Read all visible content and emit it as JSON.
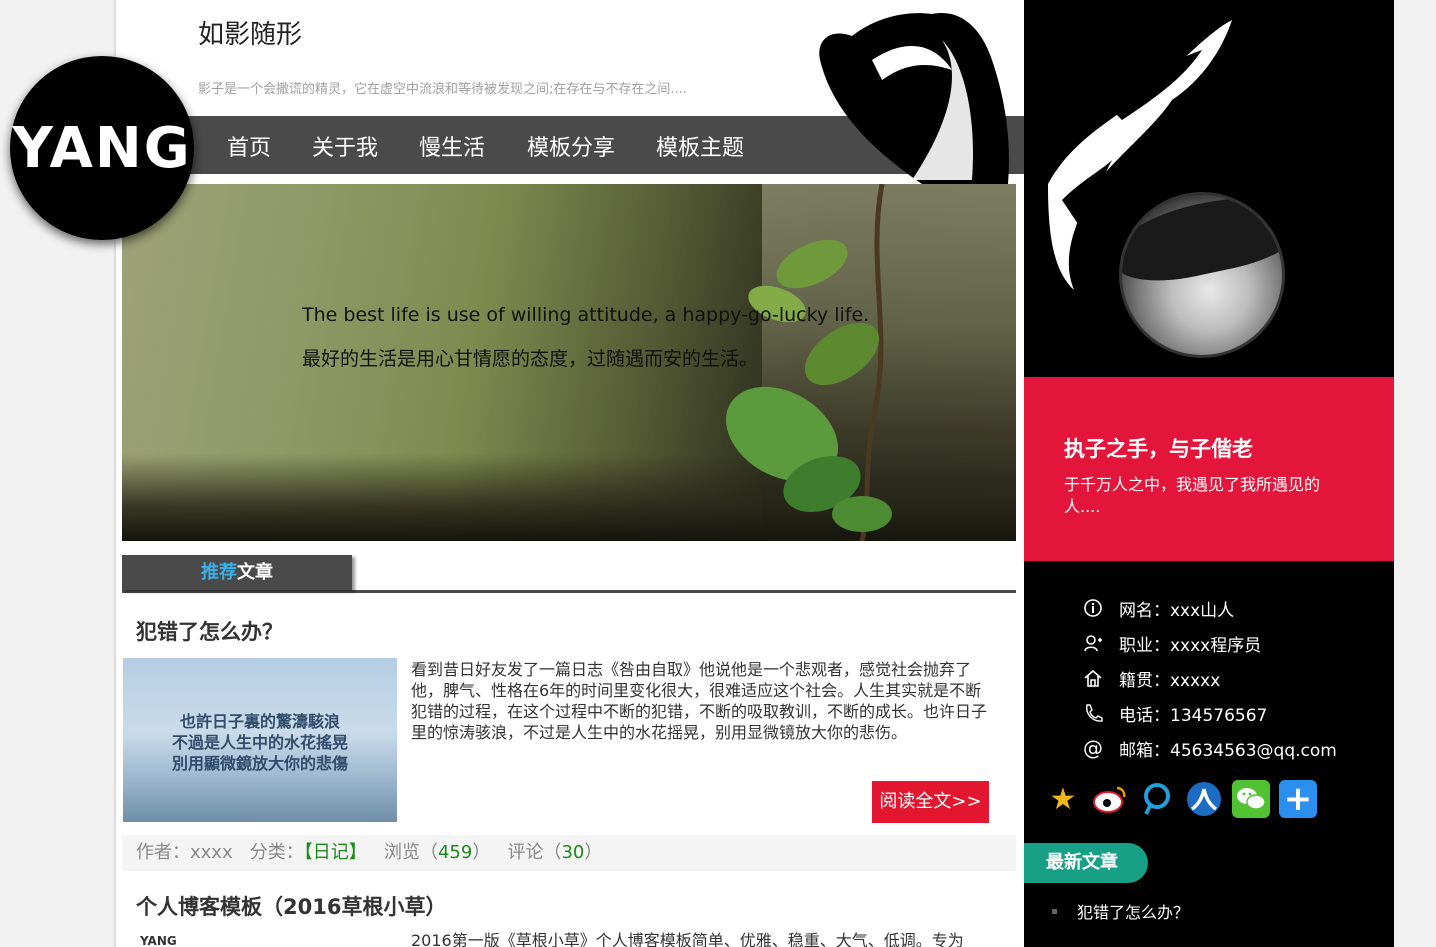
{
  "site": {
    "title": "如影随形",
    "description": "影子是一个会撒谎的精灵，它在虚空中流浪和等待被发现之间;在存在与不存在之间....",
    "logo_text": "YANG"
  },
  "nav": {
    "items": [
      "首页",
      "关于我",
      "慢生活",
      "模板分享",
      "模板主题"
    ]
  },
  "banner": {
    "text_en": "The best life is use of willing attitude, a happy-go-lucky life.",
    "text_cn": "最好的生活是用心甘情愿的态度，过随遇而安的生活。"
  },
  "recommend": {
    "tab_highlight": "推荐",
    "tab_rest": "文章"
  },
  "articles": [
    {
      "title": "犯错了怎么办？",
      "thumb_lines": [
        "也許日子裏的驚濤駭浪",
        "不過是人生中的水花搖晃",
        "別用顯微鏡放大你的悲傷"
      ],
      "body": "看到昔日好友发了一篇日志《咎由自取》他说他是一个悲观者，感觉社会抛弃了他，脾气、性格在6年的时间里变化很大，很难适应这个社会。人生其实就是不断犯错的过程，在这个过程中不断的犯错，不断的吸取教训，不断的成长。也许日子里的惊涛骇浪，不过是人生中的水花摇晃，别用显微镜放大你的悲伤。",
      "read_more": "阅读全文>>",
      "meta": {
        "author_label": "作者：",
        "author": "xxxx",
        "category_label": "分类：",
        "category": "【日记】",
        "views_label": "浏览（",
        "views": "459",
        "comments_label": "评论（",
        "comments": "30",
        "close_paren": "）"
      }
    },
    {
      "title": "个人博客模板（2016草根小草）",
      "thumb_text": "YANG",
      "body": "2016第一版《草根小草》个人博客模板简单、优雅、稳重、大气、低调。专为"
    }
  ],
  "sidebar": {
    "motto_title": "执子之手，与子偕老",
    "motto_text": "于千万人之中，我遇见了我所遇见的人....",
    "info": [
      {
        "icon": "info-icon",
        "text": "网名：xxx山人"
      },
      {
        "icon": "user-icon",
        "text": "职业：xxxx程序员"
      },
      {
        "icon": "home-icon",
        "text": "籍贯：xxxxx"
      },
      {
        "icon": "phone-icon",
        "text": "电话：134576567"
      },
      {
        "icon": "at-icon",
        "text": "邮箱：45634563@qq.com"
      }
    ],
    "social": [
      "qzone-icon",
      "weibo-icon",
      "pengyou-icon",
      "renren-icon",
      "wechat-icon",
      "more-share-icon"
    ],
    "latest_tab": "最新文章",
    "latest_items": [
      "犯错了怎么办？"
    ]
  },
  "colors": {
    "nav_bg": "#4a4a4a",
    "accent_red": "#e3153a",
    "accent_green": "#17a085",
    "highlight_blue": "#3ab0e8"
  }
}
